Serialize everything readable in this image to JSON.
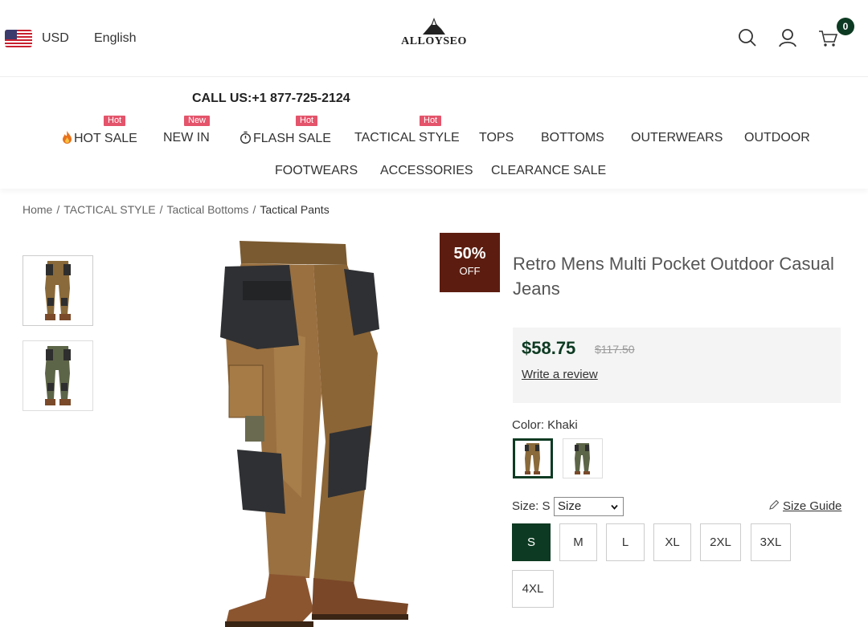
{
  "header": {
    "currency": "USD",
    "language": "English",
    "logo_text": "ALLOYSEO",
    "cart_count": "0"
  },
  "nav": {
    "call_us": "CALL US:+1 877-725-2124",
    "row1": [
      {
        "label": "HOT SALE",
        "badge": "Hot",
        "icon": "fire-icon"
      },
      {
        "label": "NEW IN",
        "badge": "New",
        "icon": ""
      },
      {
        "label": "FLASH SALE",
        "badge": "Hot",
        "icon": "stopwatch-icon"
      },
      {
        "label": "TACTICAL STYLE",
        "badge": "Hot",
        "icon": ""
      },
      {
        "label": "TOPS",
        "badge": "",
        "icon": ""
      },
      {
        "label": "BOTTOMS",
        "badge": "",
        "icon": ""
      },
      {
        "label": "OUTERWEARS",
        "badge": "",
        "icon": ""
      },
      {
        "label": "OUTDOOR",
        "badge": "",
        "icon": ""
      }
    ],
    "row2": [
      {
        "label": "FOOTWEARS"
      },
      {
        "label": "ACCESSORIES"
      },
      {
        "label": "CLEARANCE SALE"
      }
    ]
  },
  "breadcrumb": [
    "Home",
    "TACTICAL STYLE",
    "Tactical Bottoms",
    "Tactical Pants"
  ],
  "product": {
    "discount_pct": "50%",
    "discount_off": "OFF",
    "title": "Retro Mens Multi Pocket Outdoor Casual Jeans",
    "price": "$58.75",
    "old_price": "$117.50",
    "review_link": "Write a review",
    "color_label": "Color: Khaki",
    "size_label": "Size: S",
    "size_select_value": "Size",
    "size_guide": "Size Guide",
    "sizes": [
      "S",
      "M",
      "L",
      "XL",
      "2XL",
      "3XL",
      "4XL"
    ],
    "selected_size": "S"
  },
  "colors": {
    "brand_green": "#0d3a22",
    "badge_pink": "#e4546b",
    "sale_brown": "#5c1d10"
  }
}
